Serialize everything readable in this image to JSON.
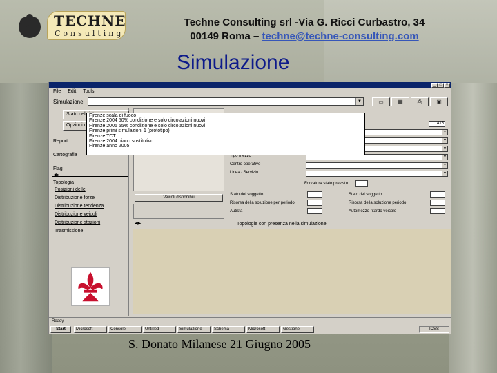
{
  "header": {
    "line1": "Techne Consulting srl -Via G. Ricci Curbastro, 34",
    "line2_prefix": "00149 Roma – ",
    "email": "techne@techne-consulting.com"
  },
  "logo": {
    "main": "TECHNE",
    "sub": "Consulting"
  },
  "slide_title": "Simulazione",
  "footer": "S. Donato Milanese 21 Giugno 2005",
  "app": {
    "menu": [
      "File",
      "Edit",
      "Tools"
    ],
    "combo_label": "Simulazione",
    "combo_value": "",
    "toolbar_icons": [
      "new-icon",
      "save-icon",
      "print-icon",
      "open-icon",
      "window-icon"
    ],
    "sidebar": {
      "tabs": [
        "Stato del sistema",
        "Opzioni di calcolo"
      ],
      "items": [
        "Report",
        "Cartografia",
        "Flag"
      ],
      "section_title": "Topologia",
      "links": [
        "Posizioni delle",
        "Distribuzione forze",
        "Distribuzione tendenza",
        "Distribuzione veicoli",
        "Distribuzione stazioni",
        "Trasmissione"
      ]
    },
    "mid_button": "Veicoli disponibili",
    "right_panel": {
      "field1_value": "415",
      "labels_left": [
        "Tipo mezzo",
        "Centro operativo",
        "Linea / Servizio"
      ],
      "select_value": "---",
      "check_label": "Forzatura stato previsto",
      "bottom_labels_left": [
        "Stato del soggetto",
        "Risorsa della soluzione per periodo",
        "Autista"
      ],
      "bottom_labels_right": [
        "Stato del soggetto",
        "Risorsa della soluzione periodo",
        "Automezzo ritardo veicolo"
      ]
    },
    "dropdown_items": [
      "Firenze scala di fuoco",
      "Firenze 2004 50% condizione e solo circolazioni nuovi",
      "Firenze 2005 55% condizione e solo circolazioni nuovi",
      "Firenze primi simulazioni 1 (prototipo)",
      "Firenze TCT",
      "Firenze 2004 piano sostitutivo",
      "Firenze anno 2005"
    ],
    "lower_title": "Topologie con presenza nella simulazione",
    "status_text": "Ready",
    "taskbar": {
      "start": "Start",
      "tasks": [
        "Microsoft",
        "Console",
        "Untitled",
        "Simulazione",
        "Schema",
        "Microsoft",
        "Gestione"
      ],
      "clock": "ICSS"
    }
  }
}
